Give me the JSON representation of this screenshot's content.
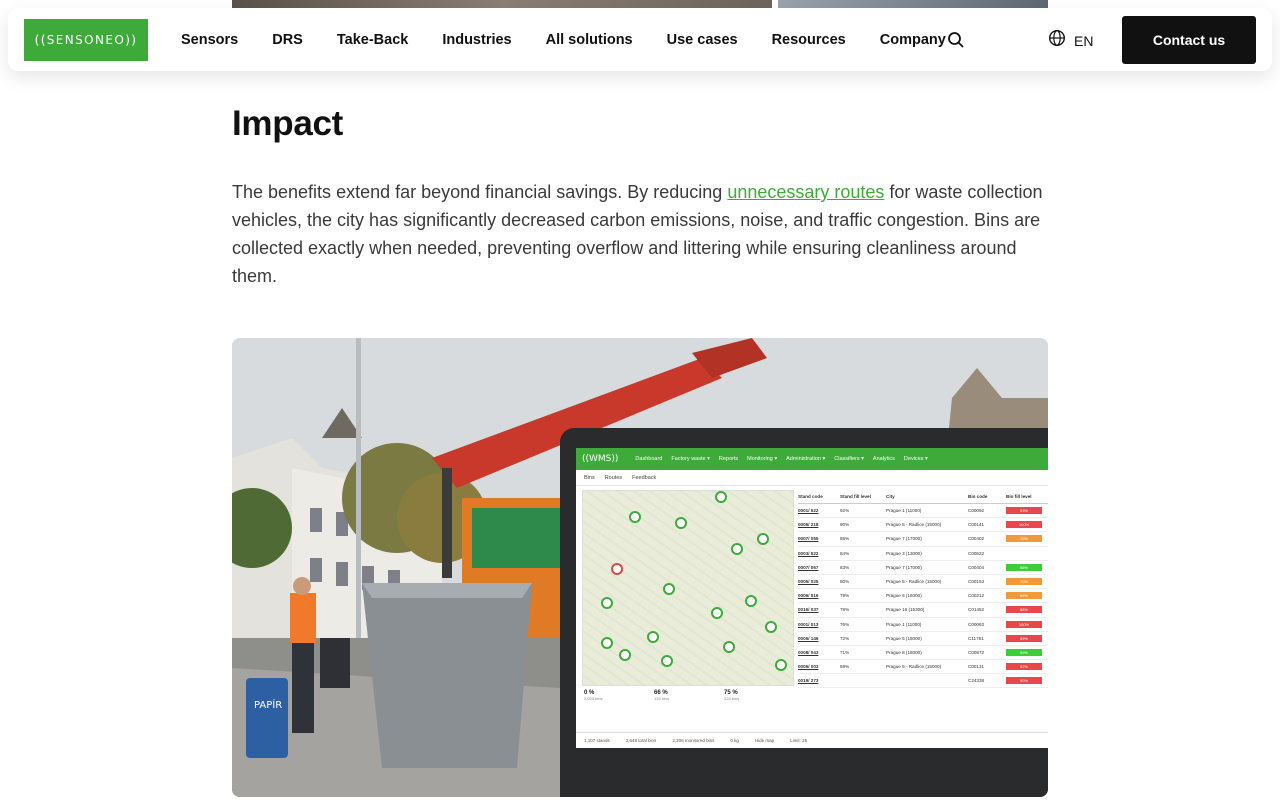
{
  "header": {
    "logo_text": "((SENSONEO))",
    "nav": [
      "Sensors",
      "DRS",
      "Take-Back",
      "Industries",
      "All solutions",
      "Use cases",
      "Resources",
      "Company"
    ],
    "search_icon": "search-icon",
    "language": "EN",
    "language_icon": "globe-icon",
    "contact_label": "Contact us",
    "brand_color": "#3daa3a"
  },
  "article": {
    "heading": "Impact",
    "para_before": "The benefits extend far beyond financial savings. By reducing ",
    "para_link": "unnecessary routes",
    "para_after": " for waste collection vehicles, the city has significantly decreased carbon emissions, noise, and traffic congestion. Bins are collected exactly when needed, preventing overflow and littering while ensuring cleanliness around them."
  },
  "dashboard": {
    "app_name": "((WMS))",
    "menu": [
      "Dashboard",
      "Factory waste ▾",
      "Reports",
      "Monitoring ▾",
      "Administration ▾",
      "Classifiers ▾",
      "Analytics",
      "Devices ▾"
    ],
    "sub_tabs": [
      "Bins",
      "Routes",
      "Feedback"
    ],
    "columns": [
      "Stand code",
      "Stand fill level",
      "City",
      "Bin code",
      "Bin fill level"
    ],
    "rows": [
      {
        "stand": "0001/ 522",
        "level": "92%",
        "city": "Prague 1 (11000)",
        "bin": "C00092",
        "fill": "93%",
        "color": "#e8484b"
      },
      {
        "stand": "0005/ 218",
        "level": "90%",
        "city": "Prague 5 - Radlice (15000)",
        "bin": "C00141",
        "fill": "100%",
        "color": "#e8484b"
      },
      {
        "stand": "0007/ 055",
        "level": "85%",
        "city": "Prague 7 (17000)",
        "bin": "C00402",
        "fill": "70%",
        "color": "#f29a3a"
      },
      {
        "stand": "0003/ 522",
        "level": "84%",
        "city": "Prague 3 (13000)",
        "bin": "C00522",
        "fill": "",
        "color": "#ffffff"
      },
      {
        "stand": "0007/ 067",
        "level": "83%",
        "city": "Prague 7 (17000)",
        "bin": "C00404",
        "fill": "56%",
        "color": "#3dcc3a"
      },
      {
        "stand": "0005/ 025",
        "level": "80%",
        "city": "Prague 5 - Radlice (15000)",
        "bin": "C00153",
        "fill": "70%",
        "color": "#f29a3a"
      },
      {
        "stand": "0006/ 516",
        "level": "79%",
        "city": "Prague 6 (16000)",
        "bin": "C00212",
        "fill": "69%",
        "color": "#f29a3a"
      },
      {
        "stand": "0016/ 037",
        "level": "78%",
        "city": "Prague 16 (15300)",
        "bin": "C01452",
        "fill": "88%",
        "color": "#e8484b"
      },
      {
        "stand": "0001/ 013",
        "level": "76%",
        "city": "Prague 1 (11000)",
        "bin": "C00063",
        "fill": "100%",
        "color": "#e8484b"
      },
      {
        "stand": "0005/ 146",
        "level": "72%",
        "city": "Prague 5 (15000)",
        "bin": "C11761",
        "fill": "89%",
        "color": "#e8484b"
      },
      {
        "stand": "0008/ 043",
        "level": "71%",
        "city": "Prague 8 (18000)",
        "bin": "C00872",
        "fill": "59%",
        "color": "#3dcc3a"
      },
      {
        "stand": "0005/ 003",
        "level": "69%",
        "city": "Prague 5 - Radlice (15000)",
        "bin": "C00131",
        "fill": "82%",
        "color": "#e8484b"
      },
      {
        "stand": "0019/ 273",
        "level": "",
        "city": "",
        "bin": "C24338",
        "fill": "90%",
        "color": "#e8484b"
      }
    ],
    "stats": [
      {
        "value": "0 %",
        "sub": "2,033 bins"
      },
      {
        "value": "66 %",
        "sub": "133 bins"
      },
      {
        "value": "75 %",
        "sub": "326 bins"
      }
    ],
    "footer": [
      "1,107 stands",
      "2,648 total bins",
      "2,206 monitored bins",
      "0 kg",
      "Hide map",
      "Limit: 25"
    ]
  }
}
